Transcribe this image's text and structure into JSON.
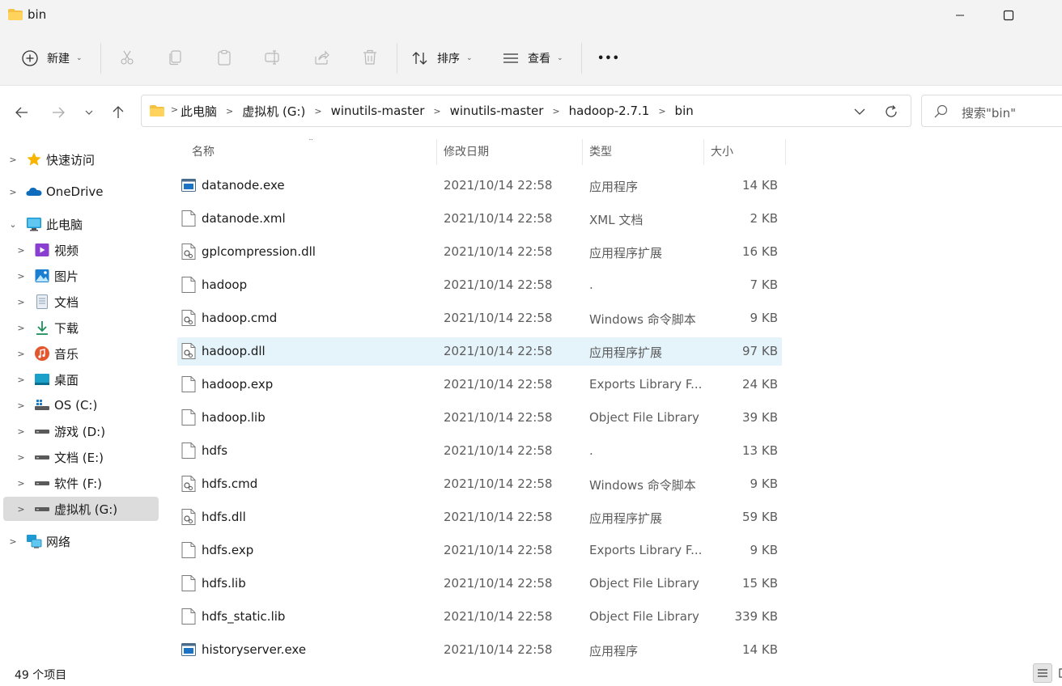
{
  "window": {
    "title": "bin"
  },
  "toolbar": {
    "new_label": "新建",
    "sort_label": "排序",
    "view_label": "查看",
    "more_label": "•••"
  },
  "breadcrumbs": [
    "此电脑",
    "虚拟机 (G:)",
    "winutils-master",
    "winutils-master",
    "hadoop-2.7.1",
    "bin"
  ],
  "search": {
    "placeholder": "搜索\"bin\""
  },
  "sidebar": {
    "items": [
      {
        "label": "快速访问",
        "icon": "star-icon"
      },
      {
        "label": "OneDrive",
        "icon": "cloud-icon"
      },
      {
        "label": "此电脑",
        "icon": "computer-icon"
      },
      {
        "label": "视频",
        "icon": "video-icon"
      },
      {
        "label": "图片",
        "icon": "pictures-icon"
      },
      {
        "label": "文档",
        "icon": "documents-icon"
      },
      {
        "label": "下载",
        "icon": "download-icon"
      },
      {
        "label": "音乐",
        "icon": "music-icon"
      },
      {
        "label": "桌面",
        "icon": "desktop-icon"
      },
      {
        "label": "OS (C:)",
        "icon": "drive-icon"
      },
      {
        "label": "游戏 (D:)",
        "icon": "drive-icon"
      },
      {
        "label": "文档 (E:)",
        "icon": "drive-icon"
      },
      {
        "label": "软件 (F:)",
        "icon": "drive-icon"
      },
      {
        "label": "虚拟机 (G:)",
        "icon": "drive-icon"
      },
      {
        "label": "网络",
        "icon": "network-icon"
      }
    ]
  },
  "columns": {
    "name": "名称",
    "date": "修改日期",
    "type": "类型",
    "size": "大小"
  },
  "files": [
    {
      "name": "datanode.exe",
      "date": "2021/10/14 22:58",
      "type": "应用程序",
      "size": "14 KB",
      "icon": "exe"
    },
    {
      "name": "datanode.xml",
      "date": "2021/10/14 22:58",
      "type": "XML 文档",
      "size": "2 KB",
      "icon": "file"
    },
    {
      "name": "gplcompression.dll",
      "date": "2021/10/14 22:58",
      "type": "应用程序扩展",
      "size": "16 KB",
      "icon": "gear"
    },
    {
      "name": "hadoop",
      "date": "2021/10/14 22:58",
      "type": ".",
      "size": "7 KB",
      "icon": "file"
    },
    {
      "name": "hadoop.cmd",
      "date": "2021/10/14 22:58",
      "type": "Windows 命令脚本",
      "size": "9 KB",
      "icon": "gear"
    },
    {
      "name": "hadoop.dll",
      "date": "2021/10/14 22:58",
      "type": "应用程序扩展",
      "size": "97 KB",
      "icon": "gear"
    },
    {
      "name": "hadoop.exp",
      "date": "2021/10/14 22:58",
      "type": "Exports Library F...",
      "size": "24 KB",
      "icon": "file"
    },
    {
      "name": "hadoop.lib",
      "date": "2021/10/14 22:58",
      "type": "Object File Library",
      "size": "39 KB",
      "icon": "file"
    },
    {
      "name": "hdfs",
      "date": "2021/10/14 22:58",
      "type": ".",
      "size": "13 KB",
      "icon": "file"
    },
    {
      "name": "hdfs.cmd",
      "date": "2021/10/14 22:58",
      "type": "Windows 命令脚本",
      "size": "9 KB",
      "icon": "gear"
    },
    {
      "name": "hdfs.dll",
      "date": "2021/10/14 22:58",
      "type": "应用程序扩展",
      "size": "59 KB",
      "icon": "gear"
    },
    {
      "name": "hdfs.exp",
      "date": "2021/10/14 22:58",
      "type": "Exports Library F...",
      "size": "9 KB",
      "icon": "file"
    },
    {
      "name": "hdfs.lib",
      "date": "2021/10/14 22:58",
      "type": "Object File Library",
      "size": "15 KB",
      "icon": "file"
    },
    {
      "name": "hdfs_static.lib",
      "date": "2021/10/14 22:58",
      "type": "Object File Library",
      "size": "339 KB",
      "icon": "file"
    },
    {
      "name": "historyserver.exe",
      "date": "2021/10/14 22:58",
      "type": "应用程序",
      "size": "14 KB",
      "icon": "exe"
    }
  ],
  "status": {
    "item_count": "49 个项目"
  },
  "colors": {
    "selection": "#e5f3fb",
    "sidebar_selected": "#dcdcdc",
    "accent": "#0067c0"
  }
}
